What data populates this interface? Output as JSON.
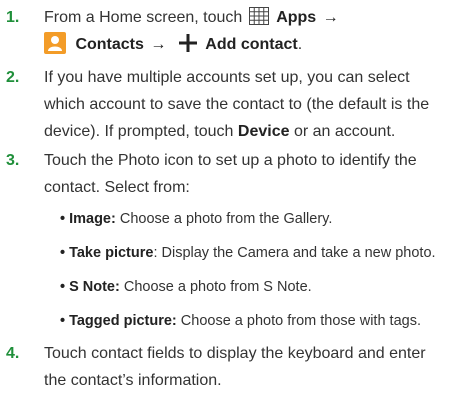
{
  "colors": {
    "step_number": "#1f8f3a",
    "text": "#333333",
    "contacts_icon_bg": "#f39c28"
  },
  "icons": {
    "apps": "apps-grid-icon",
    "contacts": "contacts-icon",
    "add": "plus-icon"
  },
  "steps": [
    {
      "number": "1.",
      "line1_prefix": "From a Home screen, touch",
      "apps_label": "Apps",
      "arrow": "→",
      "contacts_label": "Contacts",
      "add_contact_label": "Add contact",
      "end_punct": "."
    },
    {
      "number": "2.",
      "line1": "If you have multiple accounts set up, you can select",
      "line2": "which account to save the contact to (the default is the",
      "line3_prefix": "device). If prompted, touch",
      "line3_bold": "Device",
      "line3_suffix": "or an account."
    },
    {
      "number": "3.",
      "line1": "Touch the Photo icon to set up a photo to identify the",
      "line2": "contact. Select from:"
    },
    {
      "number": "4.",
      "line1": "Touch contact fields to display the keyboard and enter",
      "line2": "the contact’s information."
    }
  ],
  "photo_options": [
    {
      "bullet": "•",
      "label": "Image:",
      "text": "Choose a photo from the Gallery."
    },
    {
      "bullet": "•",
      "label": "Take picture",
      "text": ": Display the Camera and take a new photo."
    },
    {
      "bullet": "•",
      "label": "S Note:",
      "text": "Choose a photo from S Note."
    },
    {
      "bullet": "•",
      "label": "Tagged picture:",
      "text": "Choose a photo from those with tags."
    }
  ]
}
